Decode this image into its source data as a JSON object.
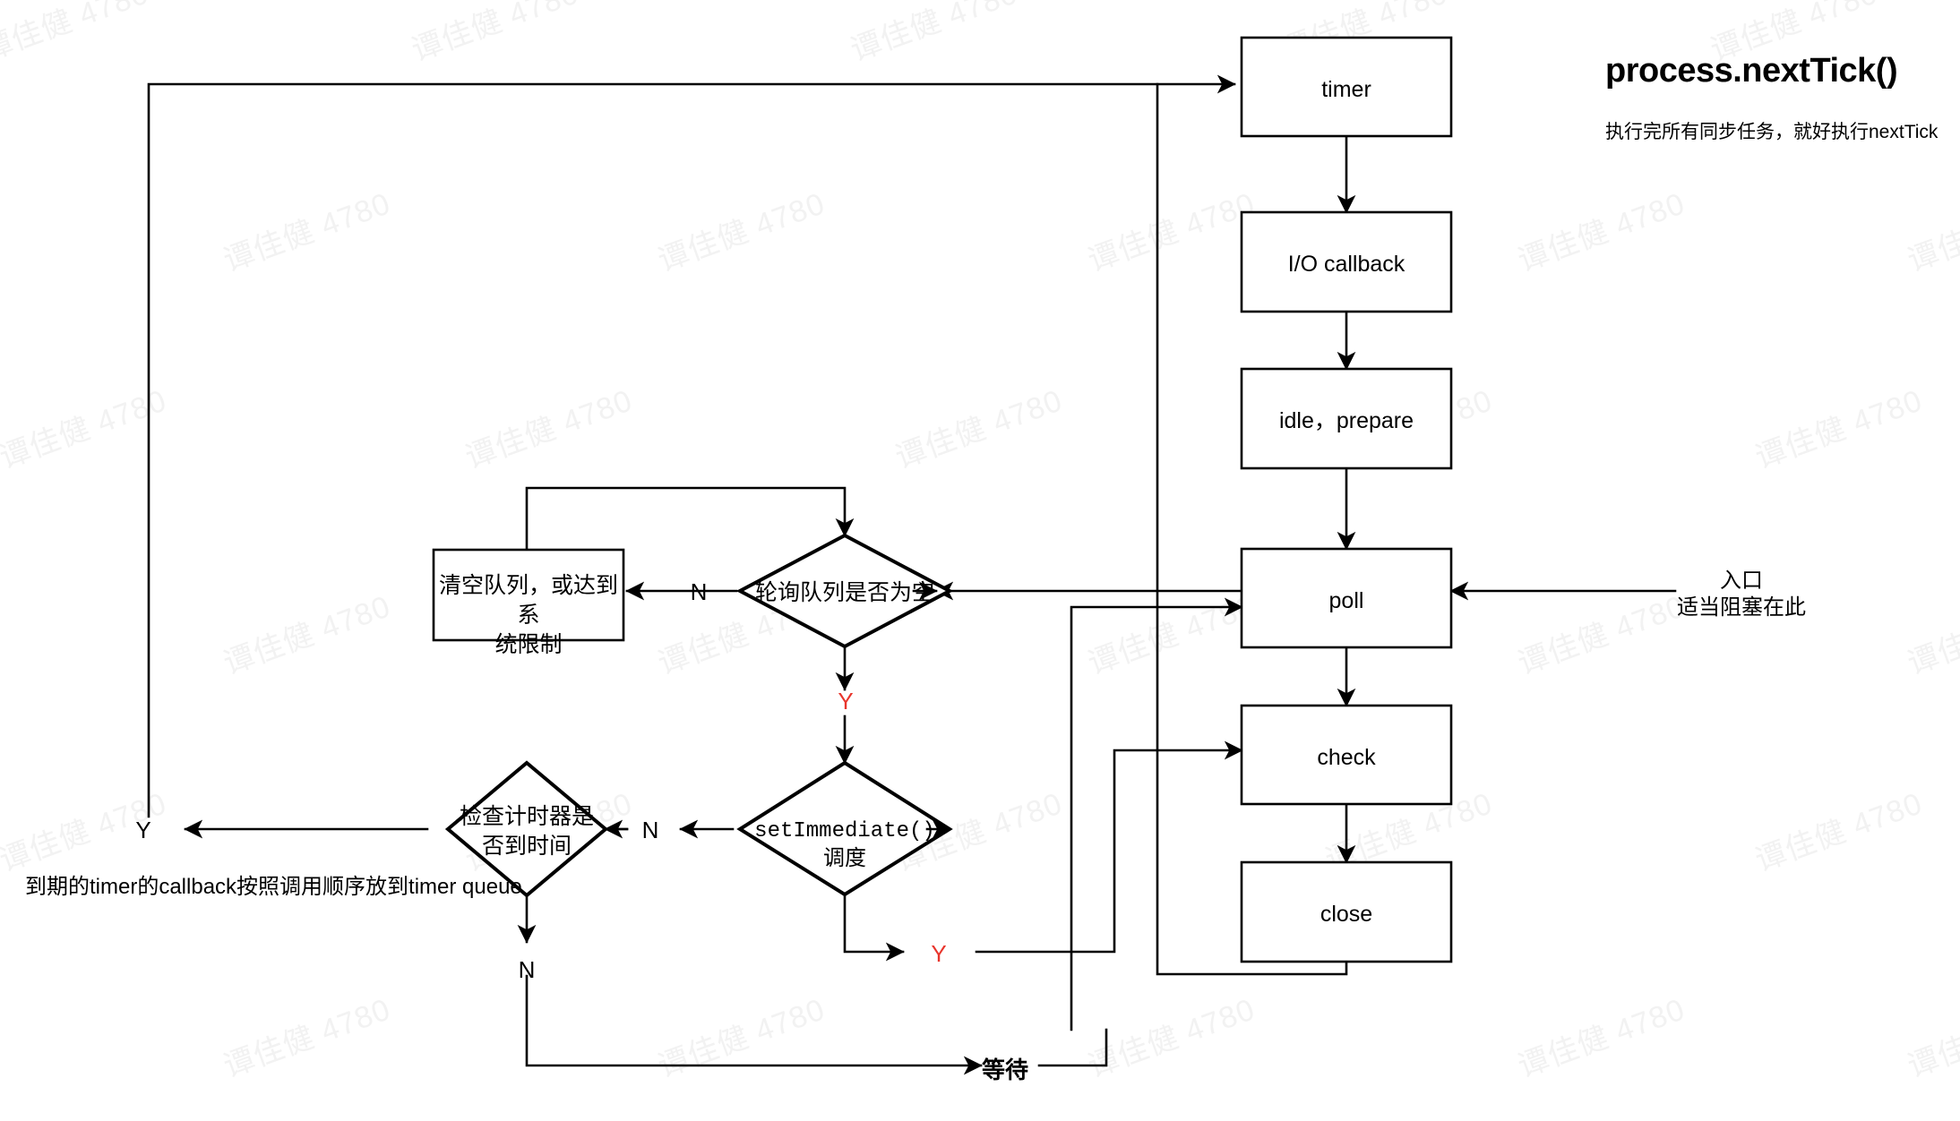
{
  "header": {
    "title": "process.nextTick()",
    "subtitle": "执行完所有同步任务，就好执行nextTick"
  },
  "watermark": {
    "text": "谭佳健 4780"
  },
  "phases": [
    {
      "id": "timer",
      "label": "timer"
    },
    {
      "id": "io-callback",
      "label": "I/O callback"
    },
    {
      "id": "idle-prepare",
      "label": "idle，prepare"
    },
    {
      "id": "poll",
      "label": "poll"
    },
    {
      "id": "check",
      "label": "check"
    },
    {
      "id": "close",
      "label": "close"
    }
  ],
  "decisions": [
    {
      "id": "poll-queue-empty",
      "label": "轮询队列是否为空"
    },
    {
      "id": "check-timer-due",
      "label": "检查计时器是\n否到时间"
    },
    {
      "id": "set-immediate-scheduled",
      "label": "setImmediate() 调度"
    }
  ],
  "process_boxes": [
    {
      "id": "drain-queue",
      "label": "清空队列，或达到系\n统限制"
    }
  ],
  "edge_labels": [
    {
      "id": "poll-empty-no",
      "text": "N",
      "color": "#000000"
    },
    {
      "id": "poll-empty-yes",
      "text": "Y",
      "color": "#e8352c"
    },
    {
      "id": "immediate-no",
      "text": "N",
      "color": "#000000"
    },
    {
      "id": "immediate-yes",
      "text": "Y",
      "color": "#e8352c"
    },
    {
      "id": "timer-due-yes",
      "text": "Y",
      "color": "#000000"
    },
    {
      "id": "timer-due-no",
      "text": "N",
      "color": "#000000"
    },
    {
      "id": "wait",
      "text": "等待",
      "color": "#000000"
    }
  ],
  "notes": [
    {
      "id": "entry-note",
      "text": "入口\n适当阻塞在此"
    },
    {
      "id": "timer-queue-note",
      "text": "到期的timer的callback按照调用顺序放到timer queue"
    }
  ],
  "colors": {
    "stroke": "#000000",
    "accent_red": "#e8352c",
    "background": "#ffffff",
    "watermark": "#f2f2f2"
  }
}
